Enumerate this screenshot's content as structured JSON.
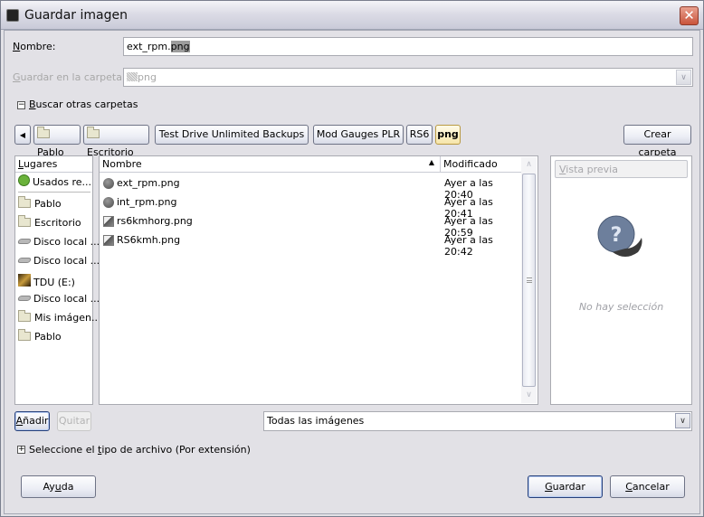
{
  "window": {
    "title": "Guardar imagen"
  },
  "form": {
    "name_label": "Nombre:",
    "name_label_mnemonic": "N",
    "name_label_rest": "ombre:",
    "name_value_plain": "ext_rpm.",
    "name_value_selected": "png",
    "folder_label_mnemonic": "G",
    "folder_label_rest": "uardar en la carpeta:",
    "folder_value": "png",
    "browse_mnemonic": "B",
    "browse_rest": "uscar otras carpetas",
    "browse_expanded": true
  },
  "pathbar": {
    "back_icon": "left-arrow-icon",
    "segments": [
      {
        "label": "Pablo",
        "icon": "folder-icon"
      },
      {
        "label": "Escritorio",
        "icon": "folder-icon"
      },
      {
        "label": "Test Drive Unlimited Backups"
      },
      {
        "label": "Mod Gauges PLR"
      },
      {
        "label": "RS6"
      },
      {
        "label": "png",
        "current": true
      }
    ],
    "create_folder": "Crear carpeta"
  },
  "places": {
    "header_mnemonic": "L",
    "header_rest": "ugares",
    "items": [
      {
        "label": "Usados re...",
        "icon": "recent-icon"
      },
      {
        "label": "Pablo",
        "icon": "folder-icon"
      },
      {
        "label": "Escritorio",
        "icon": "folder-icon"
      },
      {
        "label": "Disco local ...",
        "icon": "drive-icon"
      },
      {
        "label": "Disco local ...",
        "icon": "drive-icon"
      },
      {
        "label": "TDU (E:)",
        "icon": "tdu-drive-icon"
      },
      {
        "label": "Disco local ...",
        "icon": "drive-icon"
      },
      {
        "label": "Mis imágen...",
        "icon": "folder-icon"
      },
      {
        "label": "Pablo",
        "icon": "folder-icon"
      }
    ],
    "add_mnemonic": "A",
    "add_rest": "ñadir",
    "remove": "Quitar"
  },
  "files": {
    "columns": {
      "name": "Nombre",
      "modified": "Modificado",
      "sort": "ascending"
    },
    "rows": [
      {
        "name": "ext_rpm.png",
        "modified": "Ayer a las 20:40",
        "icon": "gauge-image-icon"
      },
      {
        "name": "int_rpm.png",
        "modified": "Ayer a las 20:41",
        "icon": "gauge-image-icon"
      },
      {
        "name": "rs6kmhorg.png",
        "modified": "Ayer a las 20:59",
        "icon": "image-file-icon"
      },
      {
        "name": "RS6kmh.png",
        "modified": "Ayer a las 20:42",
        "icon": "image-file-icon"
      }
    ]
  },
  "preview": {
    "header_mnemonic": "V",
    "header_rest": "ista previa",
    "empty_text": "No hay selección"
  },
  "filter": {
    "value": "Todas las imágenes"
  },
  "filetype": {
    "pre": "Seleccione el ",
    "mnemonic": "t",
    "post": "ipo de archivo (Por extensión)",
    "expanded": false
  },
  "buttons": {
    "help_pre": "Ay",
    "help_mnemonic": "u",
    "help_post": "da",
    "save_mnemonic": "G",
    "save_rest": "uardar",
    "cancel_mnemonic": "C",
    "cancel_rest": "ancelar"
  }
}
